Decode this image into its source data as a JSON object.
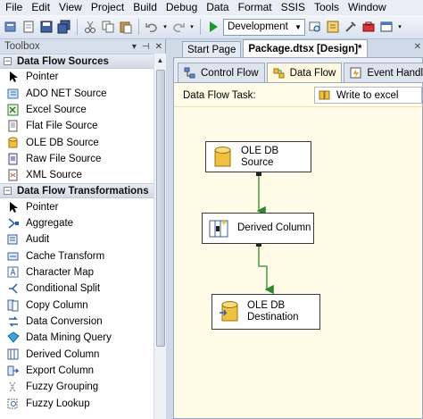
{
  "menu": [
    "File",
    "Edit",
    "View",
    "Project",
    "Build",
    "Debug",
    "Data",
    "Format",
    "SSIS",
    "Tools",
    "Window"
  ],
  "toolbar": {
    "configuration": "Development"
  },
  "toolbox": {
    "title": "Toolbox",
    "sections": [
      {
        "label": "Data Flow Sources",
        "items": [
          {
            "label": "Pointer",
            "icon": "pointer-icon"
          },
          {
            "label": "ADO NET Source",
            "icon": "ado-net-source-icon"
          },
          {
            "label": "Excel Source",
            "icon": "excel-source-icon"
          },
          {
            "label": "Flat File Source",
            "icon": "flat-file-source-icon"
          },
          {
            "label": "OLE DB Source",
            "icon": "ole-db-source-icon"
          },
          {
            "label": "Raw File Source",
            "icon": "raw-file-source-icon"
          },
          {
            "label": "XML Source",
            "icon": "xml-source-icon"
          }
        ]
      },
      {
        "label": "Data Flow Transformations",
        "items": [
          {
            "label": "Pointer",
            "icon": "pointer-icon"
          },
          {
            "label": "Aggregate",
            "icon": "aggregate-icon"
          },
          {
            "label": "Audit",
            "icon": "audit-icon"
          },
          {
            "label": "Cache Transform",
            "icon": "cache-transform-icon"
          },
          {
            "label": "Character Map",
            "icon": "character-map-icon"
          },
          {
            "label": "Conditional Split",
            "icon": "conditional-split-icon"
          },
          {
            "label": "Copy Column",
            "icon": "copy-column-icon"
          },
          {
            "label": "Data Conversion",
            "icon": "data-conversion-icon"
          },
          {
            "label": "Data Mining Query",
            "icon": "data-mining-query-icon"
          },
          {
            "label": "Derived Column",
            "icon": "derived-column-icon"
          },
          {
            "label": "Export Column",
            "icon": "export-column-icon"
          },
          {
            "label": "Fuzzy Grouping",
            "icon": "fuzzy-grouping-icon"
          },
          {
            "label": "Fuzzy Lookup",
            "icon": "fuzzy-lookup-icon"
          }
        ]
      }
    ]
  },
  "doc_tabs": [
    {
      "label": "Start Page",
      "active": false
    },
    {
      "label": "Package.dtsx [Design]*",
      "active": true
    }
  ],
  "designer_tabs": [
    {
      "label": "Control Flow",
      "icon": "control-flow-icon",
      "active": false
    },
    {
      "label": "Data Flow",
      "icon": "data-flow-icon",
      "active": true
    },
    {
      "label": "Event Handlers",
      "icon": "event-handlers-icon",
      "active": false
    }
  ],
  "data_flow_task": {
    "label": "Data Flow Task:",
    "value": "Write to excel"
  },
  "nodes": [
    {
      "id": "ole-db-source",
      "line1": "OLE DB Source",
      "line2": ""
    },
    {
      "id": "derived-column",
      "line1": "Derived Column",
      "line2": ""
    },
    {
      "id": "ole-db-destination",
      "line1": "OLE DB",
      "line2": "Destination"
    }
  ],
  "colors": {
    "path_arrow": "#2f8a2f",
    "canvas_bg": "#fffbe6",
    "db_icon": "#e3b21c"
  }
}
